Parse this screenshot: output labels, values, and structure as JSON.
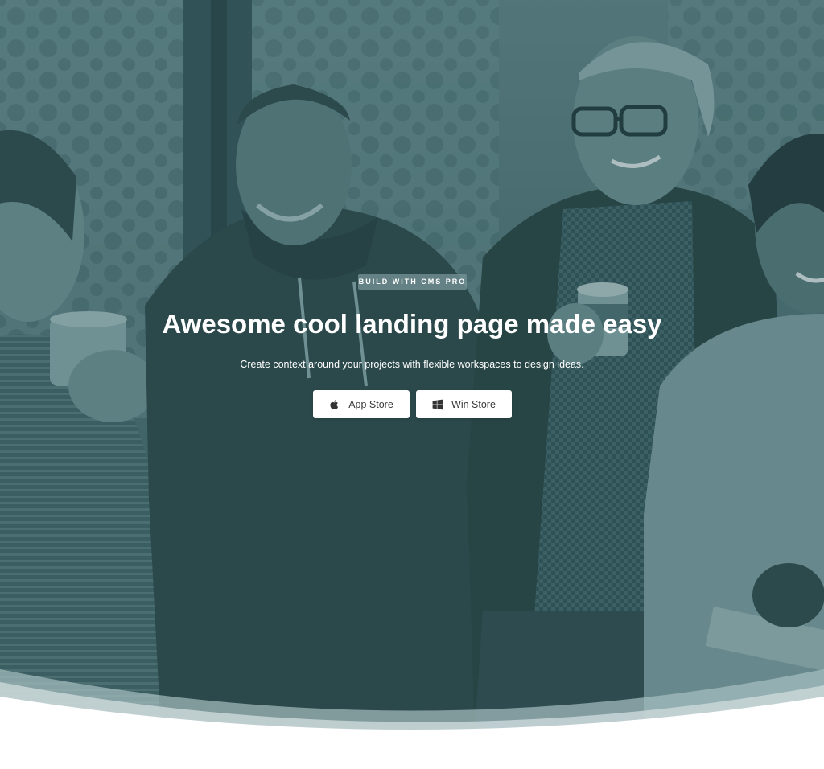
{
  "hero": {
    "badge": "BUILD WITH CMS PRO",
    "headline": "Awesome cool landing page made easy",
    "subline": "Create context around your projects with flexible workspaces to design ideas.",
    "overlay_color": "#35585c"
  },
  "buttons": {
    "app_store": {
      "label": "App Store",
      "icon": "apple-icon"
    },
    "win_store": {
      "label": "Win Store",
      "icon": "windows-icon"
    }
  }
}
